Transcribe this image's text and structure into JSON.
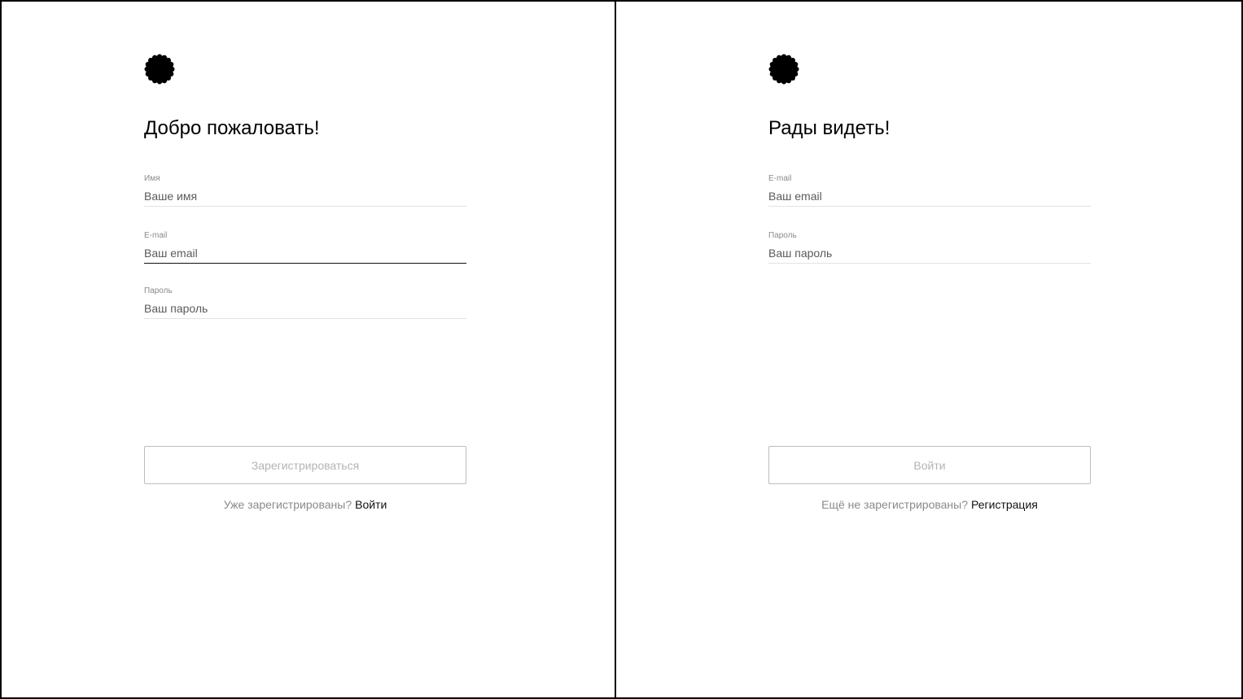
{
  "register": {
    "logo_icon": "scalloped-circle-logo",
    "title": "Добро пожаловать!",
    "fields": [
      {
        "label": "Имя",
        "placeholder": "Ваше имя",
        "value": ""
      },
      {
        "label": "E-mail",
        "placeholder": "Ваш email",
        "value": ""
      },
      {
        "label": "Пароль",
        "placeholder": "Ваш пароль",
        "value": ""
      }
    ],
    "submit_label": "Зарегистрироваться",
    "switch_question": "Уже зарегистрированы?",
    "switch_link": "Войти"
  },
  "login": {
    "logo_icon": "scalloped-circle-logo",
    "title": "Рады видеть!",
    "fields": [
      {
        "label": "E-mail",
        "placeholder": "Ваш email",
        "value": ""
      },
      {
        "label": "Пароль",
        "placeholder": "Ваш пароль",
        "value": ""
      }
    ],
    "submit_label": "Войти",
    "switch_question": "Ещё не зарегистрированы?",
    "switch_link": "Регистрация"
  },
  "colors": {
    "text": "#000000",
    "muted": "#8a8a8a",
    "divider": "#e2e2e2",
    "focused_underline": "#111111",
    "button_border": "#bdbdbd",
    "button_text_disabled": "#b4b4b4"
  }
}
